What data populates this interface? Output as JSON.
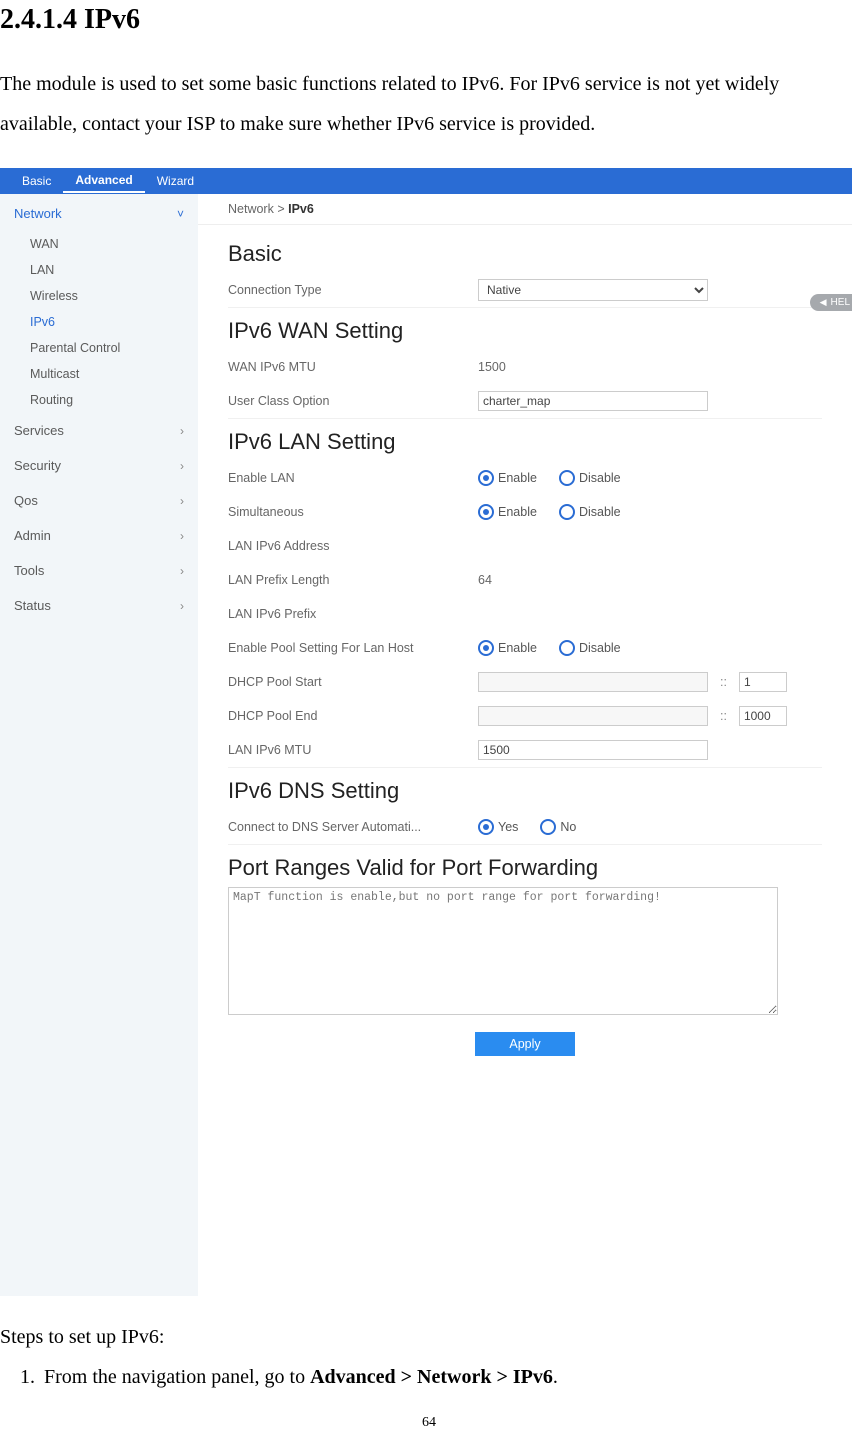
{
  "doc": {
    "heading": "2.4.1.4 IPv6",
    "intro": "The module is used to set some basic functions related to IPv6. For IPv6 service is not yet widely available, contact your ISP to make sure whether IPv6 service is provided.",
    "steps_intro": "Steps to set up IPv6:",
    "step1_prefix": "From the navigation panel, go to ",
    "step1_bold": "Advanced > Network > IPv6",
    "step1_suffix": ".",
    "page_number": "64"
  },
  "ui": {
    "topnav": {
      "basic": "Basic",
      "advanced": "Advanced",
      "wizard": "Wizard"
    },
    "breadcrumb": {
      "prefix": "Network > ",
      "current": "IPv6"
    },
    "help": "HEL",
    "sidebar": {
      "network": {
        "label": "Network",
        "items": {
          "wan": "WAN",
          "lan": "LAN",
          "wireless": "Wireless",
          "ipv6": "IPv6",
          "parental": "Parental Control",
          "multicast": "Multicast",
          "routing": "Routing"
        }
      },
      "services": "Services",
      "security": "Security",
      "qos": "Qos",
      "admin": "Admin",
      "tools": "Tools",
      "status": "Status"
    },
    "sections": {
      "basic": {
        "title": "Basic",
        "conn_type_label": "Connection Type",
        "conn_type_value": "Native"
      },
      "wan": {
        "title": "IPv6 WAN Setting",
        "mtu_label": "WAN IPv6 MTU",
        "mtu_value": "1500",
        "user_class_label": "User Class Option",
        "user_class_value": "charter_map"
      },
      "lan": {
        "title": "IPv6 LAN Setting",
        "enable_lan_label": "Enable LAN",
        "simultaneous_label": "Simultaneous",
        "addr_label": "LAN IPv6 Address",
        "prefix_len_label": "LAN Prefix Length",
        "prefix_len_value": "64",
        "prefix_label": "LAN IPv6 Prefix",
        "pool_enable_label": "Enable Pool Setting For Lan Host",
        "pool_start_label": "DHCP Pool Start",
        "pool_start_suffix": "1",
        "pool_end_label": "DHCP Pool End",
        "pool_end_suffix": "1000",
        "lan_mtu_label": "LAN IPv6 MTU",
        "lan_mtu_value": "1500"
      },
      "dns": {
        "title": "IPv6 DNS Setting",
        "auto_label": "Connect to DNS Server Automati..."
      },
      "portfwd": {
        "title": "Port Ranges Valid for Port Forwarding",
        "text": "MapT function is enable,but no port range for port forwarding!"
      }
    },
    "radio": {
      "enable": "Enable",
      "disable": "Disable",
      "yes": "Yes",
      "no": "No"
    },
    "apply": "Apply"
  }
}
